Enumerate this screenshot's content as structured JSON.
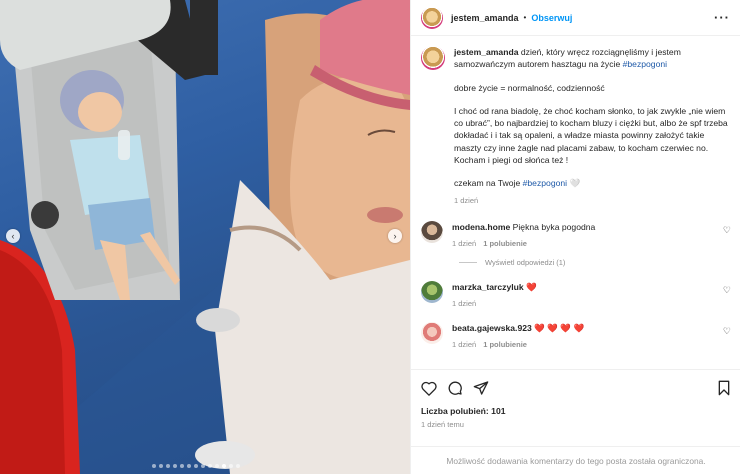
{
  "post": {
    "author": "jestem_amanda",
    "separator": "•",
    "follow_label": "Obserwuj",
    "more_icon": "more-horizontal-icon"
  },
  "caption": {
    "username": "jestem_amanda",
    "line1": " dzień, który wręcz rozciągnęliśmy i jestem samozwańczym autorem hasztagu na życie ",
    "hashtag1": "#bezpogoni",
    "para2": "dobre życie = normalność, codzienność",
    "para3": "I choć od rana biadolę, że choć kocham słonko, to jak zwykle „nie wiem co ubrać”, bo najbardziej to kocham bluzy i ciężki but, albo że spf trzeba dokładać i i tak są opaleni, a władze miasta powinny założyć takie maszty czy inne żagle nad placami zabaw, to kocham czerwiec no. Kocham i piegi od słońca też !",
    "para4": "czekam na Twoje ",
    "hashtag2": "#bezpogoni",
    "emoji": "🤍",
    "time": "1 dzień"
  },
  "comments": [
    {
      "user": "modena.home",
      "text": " Piękna byka pogodna",
      "time": "1 dzień",
      "likes": "1 polubienie",
      "replies": "Wyświetl odpowiedzi (1)"
    },
    {
      "user": "marzka_tarczyluk",
      "text": " ❤️",
      "time": "1 dzień"
    },
    {
      "user": "beata.gajewska.923",
      "text": " ❤️ ❤️ ❤️ ❤️",
      "time": "1 dzień",
      "likes": "1 polubienie"
    }
  ],
  "actions": {
    "likes": "Liczba polubień: 101",
    "when": "1 dzień temu",
    "comments_disabled": "Możliwość dodawania komentarzy do tego posta została ograniczona."
  },
  "carousel": {
    "total_slides": 13,
    "active_index": 10
  },
  "colors": {
    "link": "#0095f6",
    "hashtag": "#1f5aa8",
    "muted": "#8e8e8e"
  }
}
